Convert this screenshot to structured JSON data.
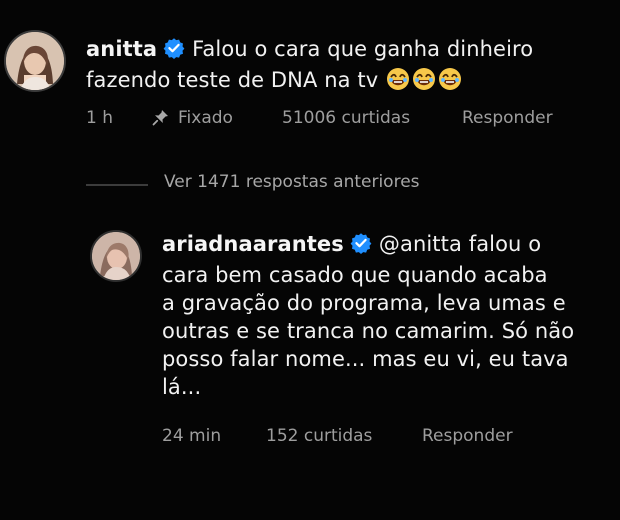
{
  "comment": {
    "username": "anitta",
    "text_line1": "Falou o cara que ganha dinheiro",
    "text_line2": "fazendo teste de DNA na tv",
    "time": "1 h",
    "pinned_label": "Fixado",
    "likes": "51006 curtidas",
    "reply_label": "Responder",
    "emoji": [
      "laughing-emoji",
      "laughing-emoji",
      "laughing-emoji"
    ]
  },
  "thread": {
    "view_replies": "Ver 1471 respostas anteriores"
  },
  "reply": {
    "username": "ariadnaarantes",
    "lines": [
      "@anitta falou o",
      "cara bem casado que quando acaba",
      "a gravação do programa, leva umas e",
      "outras e se tranca no camarim. Só não",
      "posso falar nome... mas eu vi, eu tava",
      "lá..."
    ],
    "time": "24 min",
    "likes": "152 curtidas",
    "reply_label": "Responder"
  },
  "colors": {
    "background": "#050505",
    "text": "#f2f2f2",
    "meta": "#9e9e9e",
    "verified_blue": "#1f8fff"
  }
}
